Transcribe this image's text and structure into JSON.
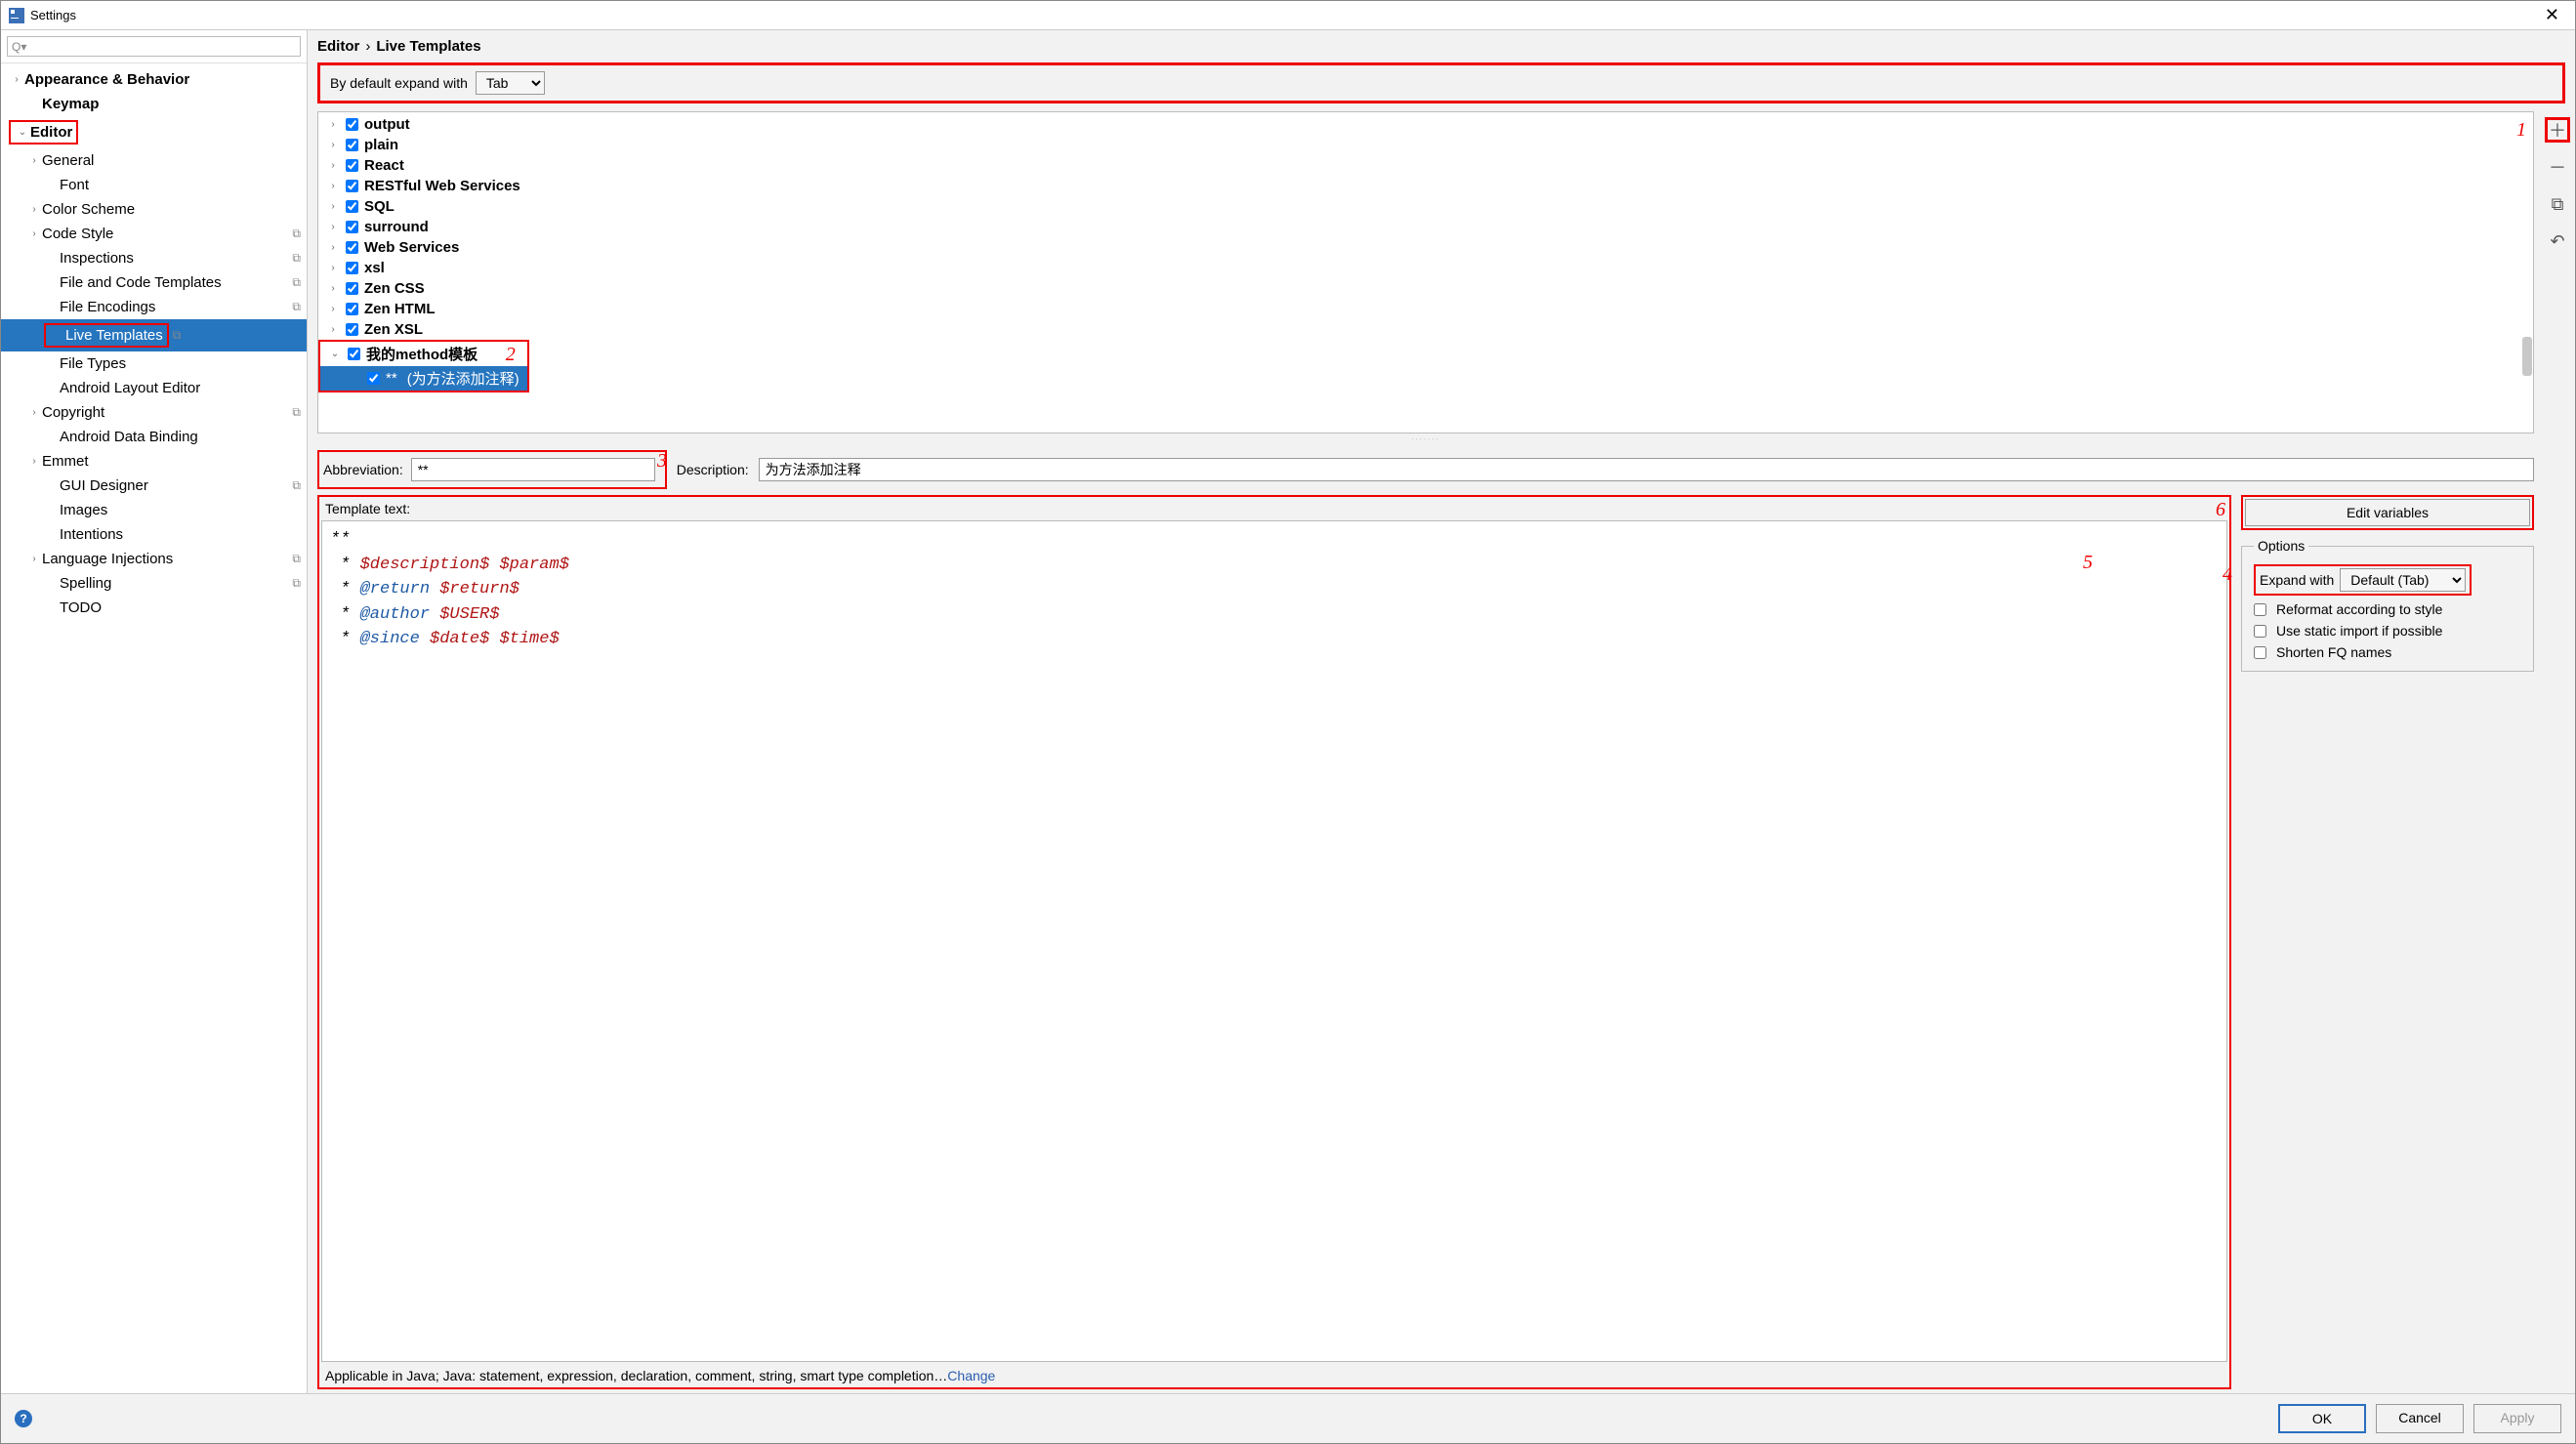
{
  "window": {
    "title": "Settings"
  },
  "sidebar": {
    "search_placeholder": "",
    "items": [
      {
        "label": "Appearance & Behavior",
        "level": 0,
        "arrow": "›",
        "bold": true
      },
      {
        "label": "Keymap",
        "level": 1,
        "arrow": "",
        "bold": true
      },
      {
        "label": "Editor",
        "level": 0,
        "arrow": "⌄",
        "bold": true,
        "red": true
      },
      {
        "label": "General",
        "level": 1,
        "arrow": "›"
      },
      {
        "label": "Font",
        "level": 2,
        "arrow": ""
      },
      {
        "label": "Color Scheme",
        "level": 1,
        "arrow": "›"
      },
      {
        "label": "Code Style",
        "level": 1,
        "arrow": "›",
        "copy": true
      },
      {
        "label": "Inspections",
        "level": 2,
        "arrow": "",
        "copy": true
      },
      {
        "label": "File and Code Templates",
        "level": 2,
        "arrow": "",
        "copy": true
      },
      {
        "label": "File Encodings",
        "level": 2,
        "arrow": "",
        "copy": true
      },
      {
        "label": "Live Templates",
        "level": 2,
        "arrow": "",
        "selected": true,
        "red": true,
        "copy": true
      },
      {
        "label": "File Types",
        "level": 2,
        "arrow": ""
      },
      {
        "label": "Android Layout Editor",
        "level": 2,
        "arrow": ""
      },
      {
        "label": "Copyright",
        "level": 1,
        "arrow": "›",
        "copy": true
      },
      {
        "label": "Android Data Binding",
        "level": 2,
        "arrow": ""
      },
      {
        "label": "Emmet",
        "level": 1,
        "arrow": "›"
      },
      {
        "label": "GUI Designer",
        "level": 2,
        "arrow": "",
        "copy": true
      },
      {
        "label": "Images",
        "level": 2,
        "arrow": ""
      },
      {
        "label": "Intentions",
        "level": 2,
        "arrow": ""
      },
      {
        "label": "Language Injections",
        "level": 1,
        "arrow": "›",
        "copy": true
      },
      {
        "label": "Spelling",
        "level": 2,
        "arrow": "",
        "copy": true
      },
      {
        "label": "TODO",
        "level": 2,
        "arrow": ""
      }
    ]
  },
  "breadcrumb": {
    "part1": "Editor",
    "sep": "›",
    "part2": "Live Templates"
  },
  "expand": {
    "label": "By default expand with",
    "value": "Tab"
  },
  "groups": [
    {
      "name": "output"
    },
    {
      "name": "plain"
    },
    {
      "name": "React"
    },
    {
      "name": "RESTful Web Services"
    },
    {
      "name": "SQL"
    },
    {
      "name": "surround"
    },
    {
      "name": "Web Services"
    },
    {
      "name": "xsl"
    },
    {
      "name": "Zen CSS"
    },
    {
      "name": "Zen HTML"
    },
    {
      "name": "Zen XSL"
    },
    {
      "name": "我的method模板",
      "expanded": true,
      "red": true,
      "children": [
        {
          "abbrev": "**",
          "desc": "(为方法添加注释)",
          "selected": true
        }
      ]
    }
  ],
  "form": {
    "abbrev_label": "Abbreviation:",
    "abbrev_value": "**",
    "desc_label": "Description:",
    "desc_value": "为方法添加注释",
    "tt_label": "Template text:",
    "tt_lines": [
      {
        "t": "plain",
        "v": "**"
      },
      {
        "t": "mix",
        "parts": [
          " * ",
          {
            "var": "$description$"
          },
          " ",
          {
            "var": "$param$"
          }
        ]
      },
      {
        "t": "mix",
        "parts": [
          " * ",
          {
            "kw": "@return"
          },
          " ",
          {
            "var": "$return$"
          }
        ]
      },
      {
        "t": "mix",
        "parts": [
          " * ",
          {
            "kw": "@author"
          },
          " ",
          {
            "var": "$USER$"
          }
        ]
      },
      {
        "t": "mix",
        "parts": [
          " * ",
          {
            "kw": "@since"
          },
          " ",
          {
            "var": "$date$"
          },
          " ",
          {
            "var": "$time$"
          }
        ]
      }
    ],
    "applicable": "Applicable in Java; Java: statement, expression, declaration, comment, string, smart type completion…",
    "change": "Change"
  },
  "rightcol": {
    "edit_variables": "Edit variables",
    "options_legend": "Options",
    "expand_with_label": "Expand with",
    "expand_with_value": "Default (Tab)",
    "reformat": "Reformat according to style",
    "static_import": "Use static import if possible",
    "shorten": "Shorten FQ names"
  },
  "annotations": {
    "a1": "1",
    "a2": "2",
    "a3": "3",
    "a4": "4",
    "a5": "5",
    "a6": "6"
  },
  "footer": {
    "ok": "OK",
    "cancel": "Cancel",
    "apply": "Apply"
  }
}
